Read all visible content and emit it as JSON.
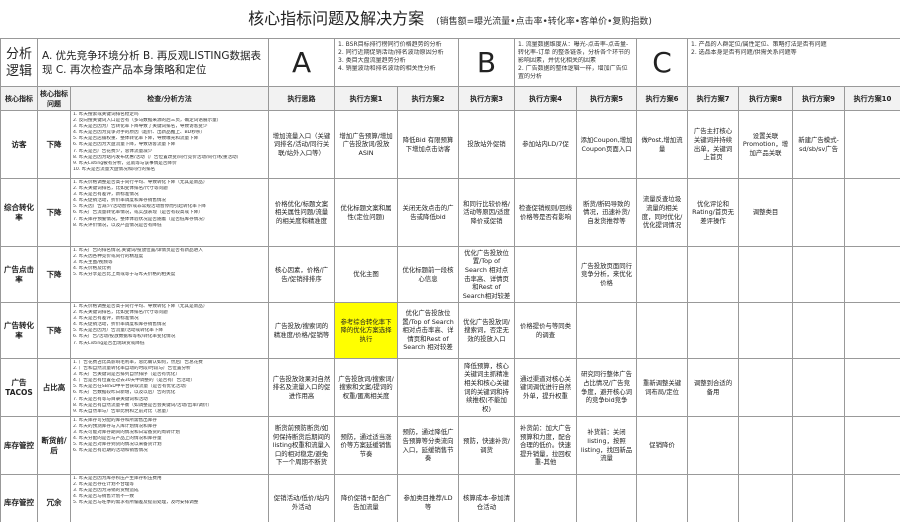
{
  "title": "核心指标问题及解决方案",
  "subtitle": "(销售额=曝光流量•点击率•转化率•客单价•复购指数)",
  "analysis_label": "分析逻辑",
  "logic_text": "A. 优先竞争环境分析 B. 再反观LISTING数据表现 C. 再次检查产品本身策略和定位",
  "options": [
    {
      "letter": "A",
      "lines": [
        "1. BSR目标排行榜同行价格趋势的分析",
        "2. 同行近期促销活动/排名波动原因分析",
        "3. 类目大盘流量趋势分析",
        "4. 销量波动和排名波动的相关性分析"
      ]
    },
    {
      "letter": "B",
      "lines": [
        "1. 流量数据维度从：曝光-点击率-点击量-",
        "转化率-订单 的整条链条，分析各个环节的",
        "影响因素，并优化相关的因素",
        "2. 广告数据的整体逻辑一样，增加广告位",
        "置的分析"
      ]
    },
    {
      "letter": "C",
      "lines": [
        "1. 产品的人群定位/属性定位、策略打法是否有问题",
        "2. 选品本身是否有问题/供需关系问题等"
      ]
    }
  ],
  "headers": [
    "核心指标",
    "核心指标问题",
    "检查/分析方法",
    "执行思路",
    "执行方案1",
    "执行方案2",
    "执行方案3",
    "执行方案4",
    "执行方案5",
    "执行方案6",
    "执行方案7",
    "执行方案8",
    "执行方案9",
    "执行方案10"
  ],
  "rows": [
    {
      "k1": "访客",
      "k2": "下降",
      "method": [
        "1. 昨天搜索或关键词排名稳定吗",
        "2. 反向搜关键词入口是否有（多马数据来源的后三页，确定词语展示量）",
        "3. 昨天是否因为广告转化率下降导致了关键词排名，导致访客变少",
        "4. 昨天是否因为竞争对手的原因（超价、出新品推上、BD秒杀）",
        "5. 昨天是否店铺权重、整体转化率下降，导致曝光和流量下降",
        "6. 昨天是否因为大盘流量下降，导致访客流量下降",
        "7. 昨天是否广告花费少，总体流量减少",
        "8. 昨天是否因为站内发布优惠/活动（广告位置改变/同行竞价活动/同行/权重活动）",
        "9. 昨天Listing被有分析，这就等与该事情是否降价",
        "10. 昨天是否流量大盘情况和同行的排名"
      ],
      "idea": "增加流量入口（关键词排名/活动/同行关联/站外入口等）",
      "p": [
        "增加广告预算/增加广告投放词/投放ASIN",
        "降低Bid 有限预算下增加点击访客",
        "投放站外促销",
        "参加站内LD/7促",
        "添加Coupon,增加Coupon页面入口",
        "做Post,增加流量",
        "广告主打核心关键词并持续出单，关键词上首页",
        "设置关联Promotion，增加产品关联",
        "新建广告模式-sd/sb/sv广告",
        ""
      ]
    },
    {
      "k1": "综合转化率",
      "k2": "下降",
      "method": [
        "1. 昨天价格调整是否高于同行平均、导致转化下降（尤其是新品）",
        "2. 昨天关键词排名，比如变体排名/尺寸等问题",
        "3. 昨天是否有差评，新标准情况",
        "4. 昨天促销活动，折价率调度和库存销售情况",
        "5. 昨天因广告减少/活动暂停/或非常规活动暂停而引起转化率下降",
        "6. 昨天广告流量转化率情况，或实战表现（是否有较高或下降）",
        "7. 昨天库存预警情况，整体体验状况是否随着（是否低库存情况）",
        "8. 昨天评价情况，以及产品情况是否有降低"
      ],
      "idea": "价格优化/标题文案相关属性问题/流量的相关度和精准度",
      "p": [
        "优化标题文案和属性(定位问题)",
        "关闭无效点击的广告或降低bid",
        "和同行比较价格/活动等原因/适度降价或促销",
        "检查促销规则/回线价格等是否有影响",
        "断货/断码导致的情况，迅速补货/自发货推荐等",
        "流量反查垃圾流量的相关度，同时优化/优化提词情况",
        "优化评论和Rating/首页无差评操作",
        "调整类目",
        ""
      ]
    },
    {
      "k1": "广告点击率",
      "k2": "下降",
      "method": [
        "1. 昨天广告的排名情况,关键词/投放位置/详情页是否有新品进入",
        "2. 昨天因各种竞价或同行的精准度",
        "3. 昨天主图/视频等",
        "4. 昨天价格及比例",
        "5. 昨天分享是否比上周或等于与昨天价格的相关度"
      ],
      "idea": "核心因素，价格/广告/促销排排序",
      "p": [
        "优化主图",
        "优化标题前一段核心信息",
        "优化广告投放位置/Top of Search 相对点击率高、详情页和Rest of Search相对较差",
        "",
        "广告投放页面同行竞争分析，来优化价格",
        "",
        "",
        "",
        "",
        ""
      ]
    },
    {
      "k1": "广告转化率",
      "k2": "下降",
      "method": [
        "1. 昨天价格调整是否高于同行平均、导致转化下降（尤其是新品）",
        "2. 昨天关键词排名，比如变体排名/尺寸等问题",
        "3. 昨天是否有差评，新标准情况",
        "4. 昨天促销活动，折价率调度和库存销售情况",
        "5. 昨天是否因为广告流量/活动或转化率下降",
        "6. 昨天广告/活动/投放数据和等权/转化率变化情况",
        "7. 昨天Listing是否出现缺货或降低"
      ],
      "idea": "广告投放/搜索词的精准度/价格/促销等",
      "p": [
        "参考综合转化率下降的优化方案选择执行",
        "优化广告投放位置/Top of Search 相对点击率高、详情页和Rest of Search 相对较差",
        "优化广告投放词/搜索词，否定无效的投放入口",
        "价格提价与等同类的调查",
        "",
        "",
        "",
        "",
        "",
        ""
      ]
    },
    {
      "k1": "广告TACOS",
      "k2": "占比高",
      "method": [
        "1. 广告花费占比高影响毛利率，总比确认如何，然后广告总花费",
        "2. 广告和自然流量转化率自动的时段/时段与广告位置分析",
        "3. 昨天广告关键词是否排列自然排序（是否有优化）",
        "4. 广告是否有位置在过去30天中调整的（是否有广告活动）",
        "5. 昨天是否在SB/SD中平台获取流量（是否有优化活动）",
        "6. 昨天广告数据较昨日新增，以及以后广告的优化",
        "7. 昨天是否有等与目录关键词和活动",
        "8. 昨天是否有自然流量平衡（如调整是否会关键词/活动/出单/调价）",
        "9. 昨天自然单与广告单比例和之前对比（总量）"
      ],
      "idea": "广告投放效果对自然排名及流量入口的促进作用高",
      "p": [
        "广告投放词/搜索词/搜索和文案/提词的权重/匿离相关度",
        "",
        "降低预算，核心关键词主抓精准相关和核心关键词的关键词和持续推权(不能加权)",
        "通过渠道对核心关键词调优进行自然外单，提升权重",
        "研究同行整体广告占比情况/广告竞争度，避开核心词的竞争bid竞争",
        "重新调整关键词布局/定位",
        "调整到合适的备用",
        "",
        "",
        ""
      ]
    },
    {
      "k1": "库存管控",
      "k2": "断货前/后",
      "method": [
        "1. 昨天库存可分配的库存和所需售出库存",
        "2. 昨天的预测库存与入库计划情况和库存",
        "3. 昨天可能对库存期间的情况和日常备货的周转计划",
        "4. 昨天分配的是否与产品上的情况和库存量",
        "5. 昨天是否对库存到货的情况以来备货计划",
        "6. 昨天是否有近期的活动和销售情况"
      ],
      "idea": "断货前预防断货/如何保持断货后期间的listing权重和流量入口的相对稳定/避免下一个周期不断货",
      "p": [
        "预防，通过适当涨价等方案延缓销售节奏",
        "预防，通过降低广告预算等分类流向入口，延缓销售节奏",
        "预防，快速补货/调货",
        "补货前：加大广告预算和力度，配合合理的低价。快速提升销量，拉回权重-其他",
        "补货前：关闭listing，按照listing，找回新品流量",
        "促销降价",
        "",
        "",
        "",
        ""
      ]
    },
    {
      "k1": "库存管控",
      "k2": "冗余",
      "method": [
        "1. 昨天是否因为库存积压产生库存积压费用",
        "2. 昨天是否存在计划不合理等",
        "3. 昨天是否因为滞销的货物造成",
        "4. 昨天是否与销售计划不一致",
        "5. 昨天是否与旺季的需求有所偏差及提前处理，及时安排调整"
      ],
      "idea": "促销活动/低价/站内外活动",
      "p": [
        "降价促销+配合广告加流量",
        "参加类目推荐/LD等",
        "核算成本-参加清仓活动",
        "",
        "",
        "",
        "",
        "",
        "",
        ""
      ]
    }
  ]
}
